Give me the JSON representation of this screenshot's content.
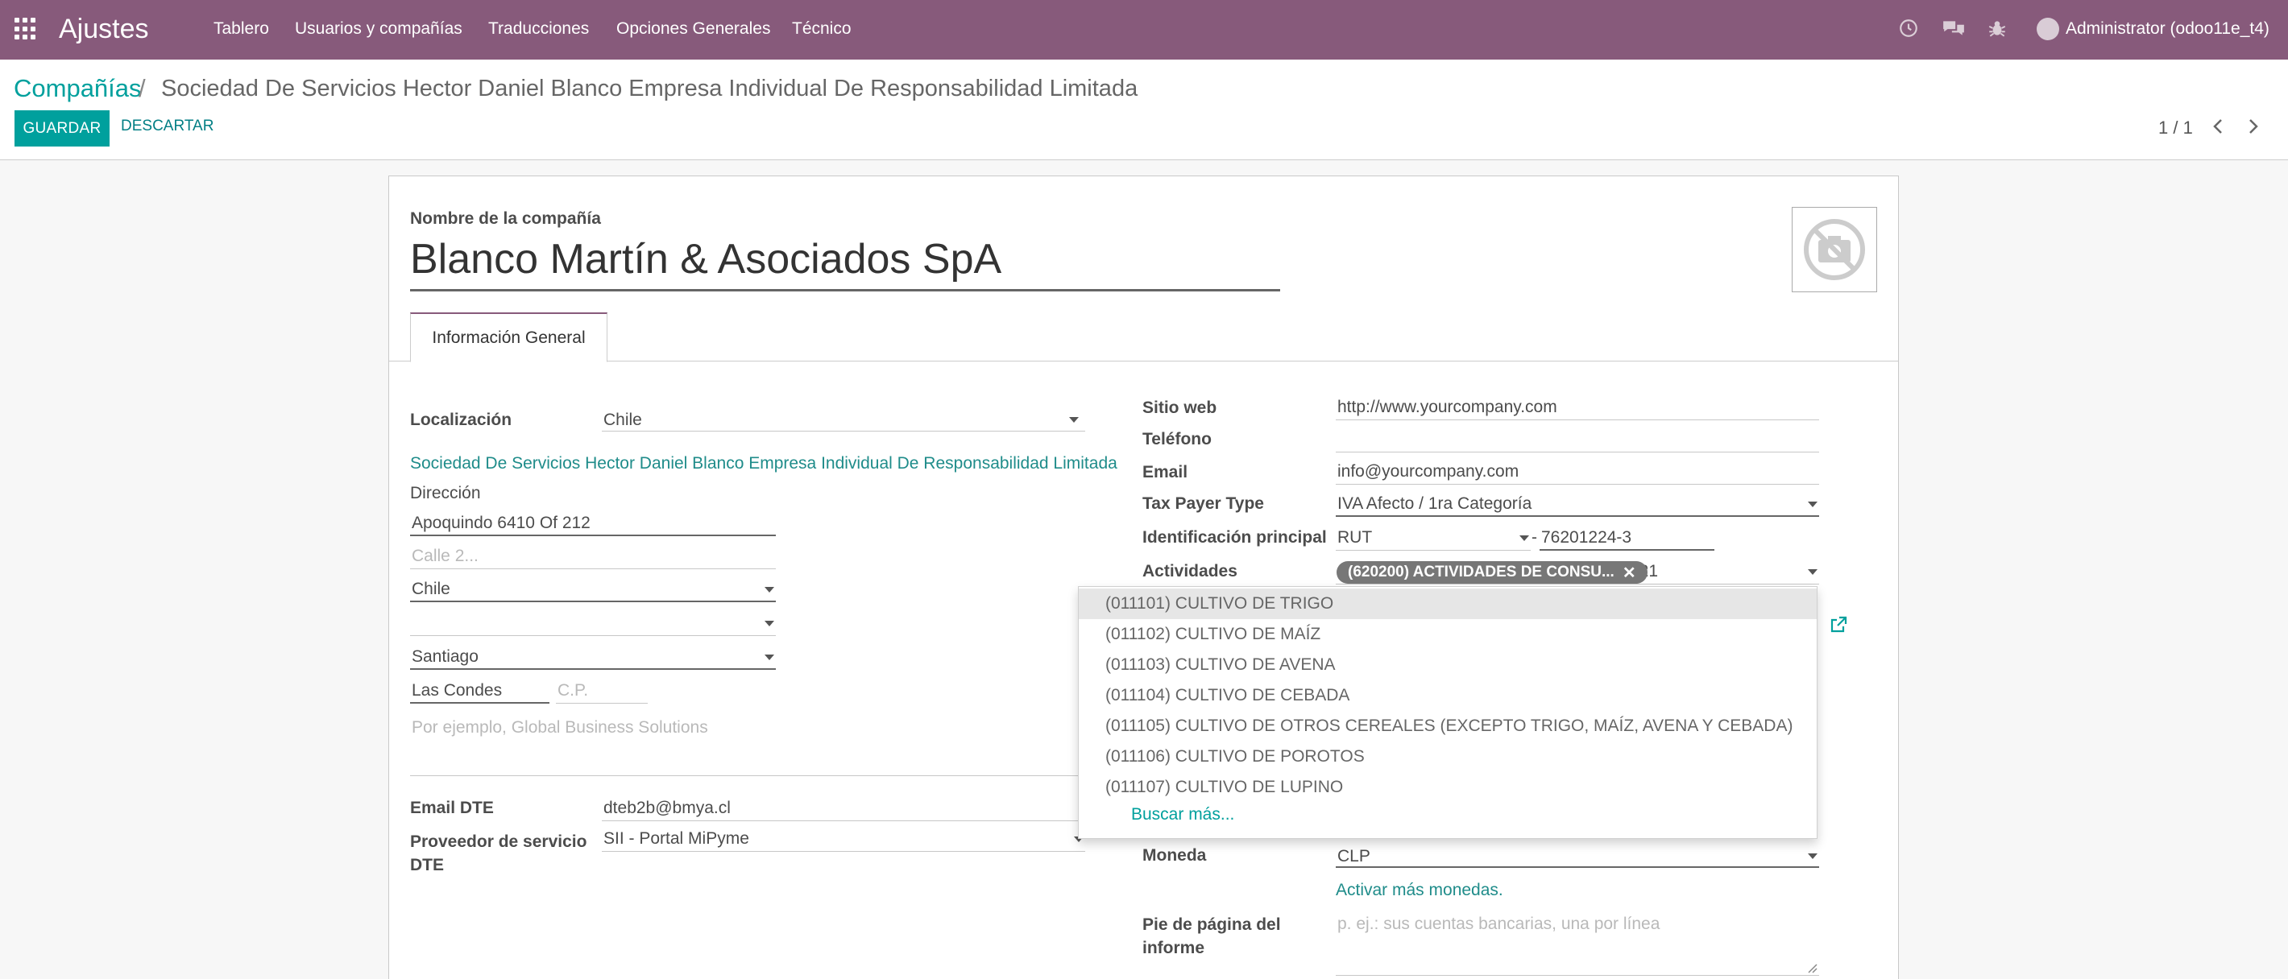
{
  "navbar": {
    "app_title": "Ajustes",
    "menu": [
      "Tablero",
      "Usuarios y compañías",
      "Traducciones",
      "Opciones Generales",
      "Técnico"
    ],
    "user": "Administrator (odoo11e_t4)",
    "brand_color": "#875a7b"
  },
  "breadcrumb": {
    "parent": "Compañías",
    "separator": "/",
    "current": "Sociedad De Servicios Hector Daniel Blanco Empresa Individual De Responsabilidad Limitada"
  },
  "toolbar": {
    "save_label": "GUARDAR",
    "discard_label": "DESCARTAR",
    "pager": "1 / 1"
  },
  "form": {
    "company_name_label": "Nombre de la compañía",
    "company_name": "Blanco Martín & Asociados SpA",
    "tab_general": "Información General",
    "localization_label": "Localización",
    "localization_value": "Chile",
    "legal_name": "Sociedad De Servicios Hector Daniel Blanco Empresa Individual De Responsabilidad Limitada",
    "address_label": "Dirección",
    "street": "Apoquindo 6410 Of 212",
    "street2_placeholder": "Calle 2...",
    "country": "Chile",
    "state": "",
    "city": "Santiago",
    "district": "Las Condes",
    "zip_placeholder": "C.P.",
    "company_registry_placeholder": "Por ejemplo, Global Business Solutions",
    "email_dte_label": "Email DTE",
    "email_dte": "dteb2b@bmya.cl",
    "dte_provider_label": "Proveedor de servicio DTE",
    "dte_provider_label_line1": "Proveedor de servicio",
    "dte_provider_label_line2": "DTE",
    "dte_provider": "SII - Portal MiPyme",
    "website_label": "Sitio web",
    "website": "http://www.yourcompany.com",
    "phone_label": "Teléfono",
    "phone": "",
    "email_label": "Email",
    "email": "info@yourcompany.com",
    "taxpayer_label": "Tax Payer Type",
    "taxpayer": "IVA Afecto / 1ra Categoría",
    "main_id_label": "Identificación principal",
    "main_id_type": "RUT",
    "main_id_separator": "-",
    "main_id_number": "76201224-3",
    "activities_label": "Actividades",
    "activity_tag": "(620200) ACTIVIDADES DE CONSU...",
    "activity_search": "721",
    "currency_label": "Moneda",
    "currency": "CLP",
    "more_currencies": "Activar más monedas.",
    "report_footer_label": "Pie de página del informe",
    "report_footer_line1": "Pie de página del",
    "report_footer_line2": "informe",
    "report_footer_placeholder": "p. ej.: sus cuentas bancarias, una por línea"
  },
  "dropdown": {
    "items": [
      "(011101) CULTIVO DE TRIGO",
      "(011102) CULTIVO DE MAÍZ",
      "(011103) CULTIVO DE AVENA",
      "(011104) CULTIVO DE CEBADA",
      "(011105) CULTIVO DE OTROS CEREALES (EXCEPTO TRIGO, MAÍZ, AVENA Y CEBADA)",
      "(011106) CULTIVO DE POROTOS",
      "(011107) CULTIVO DE LUPINO"
    ],
    "more": "Buscar más..."
  },
  "icons": {
    "apps": "apps-grid-icon",
    "clock": "clock-icon",
    "chat": "chat-icon",
    "bug": "bug-icon",
    "prev": "chevron-left-icon",
    "next": "chevron-right-icon",
    "external": "external-link-icon",
    "camera": "no-image-camera-icon"
  }
}
